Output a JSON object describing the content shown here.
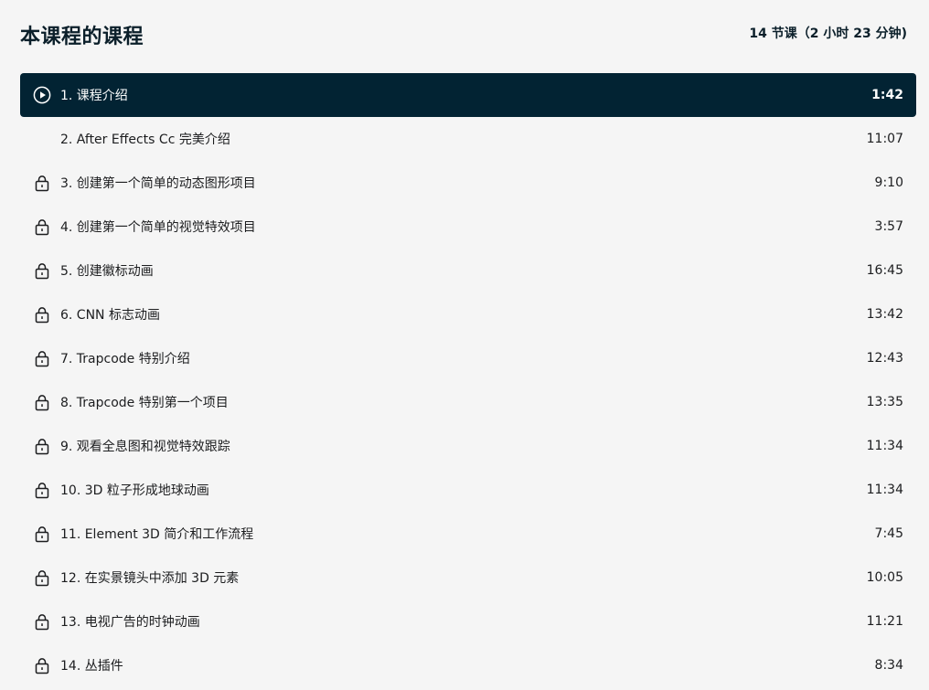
{
  "header": {
    "title": "本课程的课程",
    "summary": "14 节课（2 小时 23 分钟)"
  },
  "lessons": [
    {
      "label": "1. 课程介绍",
      "duration": "1:42",
      "icon": "play-circle-icon",
      "active": true
    },
    {
      "label": "2. After Effects Cc 完美介绍",
      "duration": "11:07",
      "icon": "none",
      "active": false
    },
    {
      "label": "3. 创建第一个简单的动态图形项目",
      "duration": "9:10",
      "icon": "lock-icon",
      "active": false
    },
    {
      "label": "4. 创建第一个简单的视觉特效项目",
      "duration": "3:57",
      "icon": "lock-icon",
      "active": false
    },
    {
      "label": "5. 创建徽标动画",
      "duration": "16:45",
      "icon": "lock-icon",
      "active": false
    },
    {
      "label": "6. CNN 标志动画",
      "duration": "13:42",
      "icon": "lock-icon",
      "active": false
    },
    {
      "label": "7. Trapcode 特别介绍",
      "duration": "12:43",
      "icon": "lock-icon",
      "active": false
    },
    {
      "label": "8. Trapcode 特别第一个项目",
      "duration": "13:35",
      "icon": "lock-icon",
      "active": false
    },
    {
      "label": "9. 观看全息图和视觉特效跟踪",
      "duration": "11:34",
      "icon": "lock-icon",
      "active": false
    },
    {
      "label": "10. 3D 粒子形成地球动画",
      "duration": "11:34",
      "icon": "lock-icon",
      "active": false
    },
    {
      "label": "11. Element 3D 简介和工作流程",
      "duration": "7:45",
      "icon": "lock-icon",
      "active": false
    },
    {
      "label": "12. 在实景镜头中添加 3D 元素",
      "duration": "10:05",
      "icon": "lock-icon",
      "active": false
    },
    {
      "label": "13. 电视广告的时钟动画",
      "duration": "11:21",
      "icon": "lock-icon",
      "active": false
    },
    {
      "label": "14. 丛插件",
      "duration": "8:34",
      "icon": "lock-icon",
      "active": false
    }
  ],
  "colors": {
    "background": "#f5f5f5",
    "active_row_bg": "#022333",
    "text": "#1c1d1f",
    "title": "#0b1f2a"
  }
}
